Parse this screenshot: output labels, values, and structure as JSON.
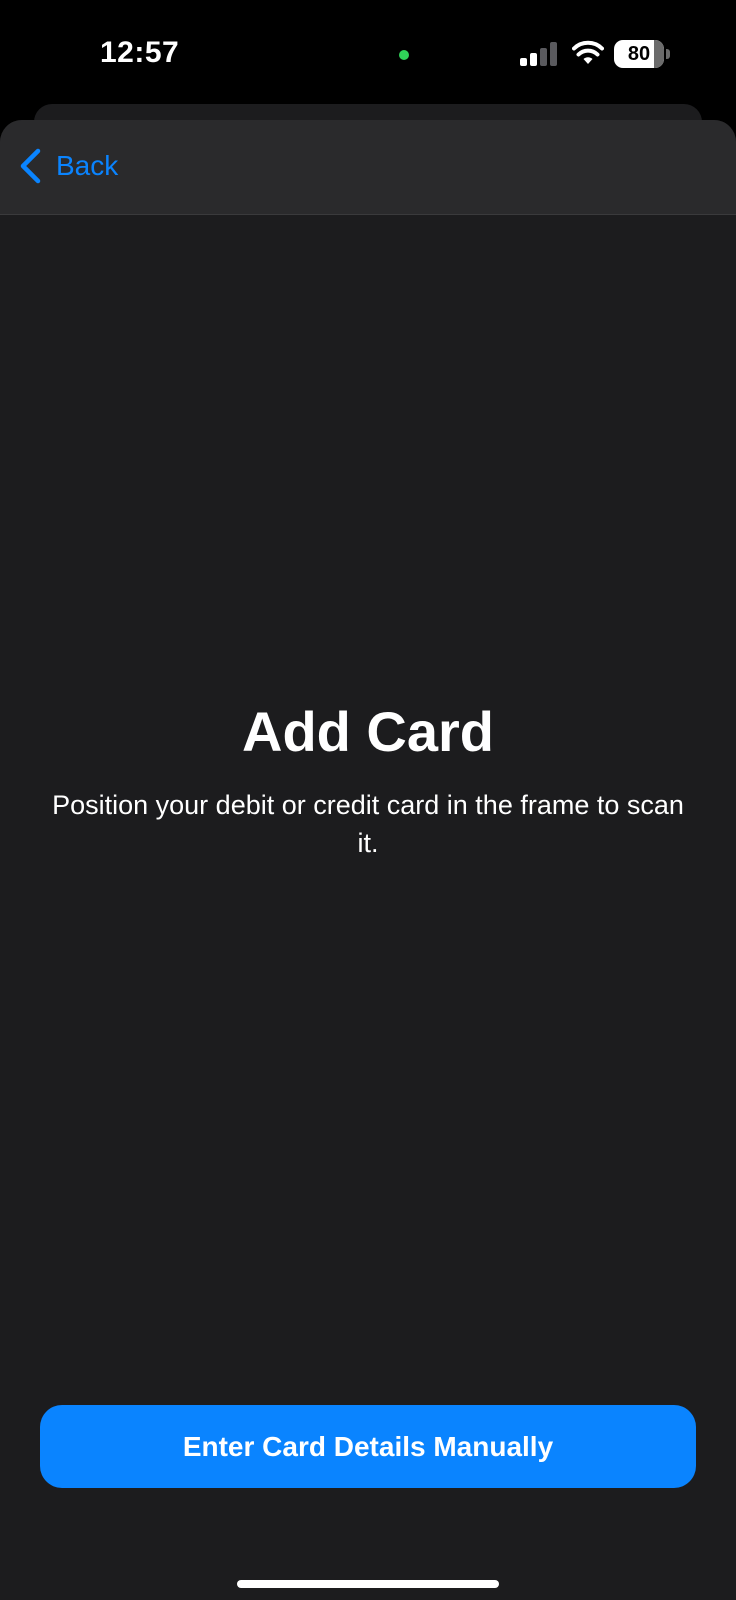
{
  "status_bar": {
    "time": "12:57",
    "battery_level": "80",
    "battery_fraction": 0.8,
    "signal_bars_active": 2,
    "signal_bars_total": 4,
    "camera_indicator_color": "#30d158"
  },
  "nav": {
    "back_label": "Back"
  },
  "main": {
    "title": "Add Card",
    "subtitle": "Position your debit or credit card in the frame to scan it."
  },
  "actions": {
    "manual_entry_label": "Enter Card Details Manually"
  },
  "colors": {
    "accent": "#0a84ff",
    "background": "#1c1c1e",
    "nav_background": "#2a2a2c"
  },
  "icons": {
    "back": "chevron-left-icon",
    "signal": "cellular-signal-icon",
    "wifi": "wifi-icon",
    "battery": "battery-icon"
  }
}
